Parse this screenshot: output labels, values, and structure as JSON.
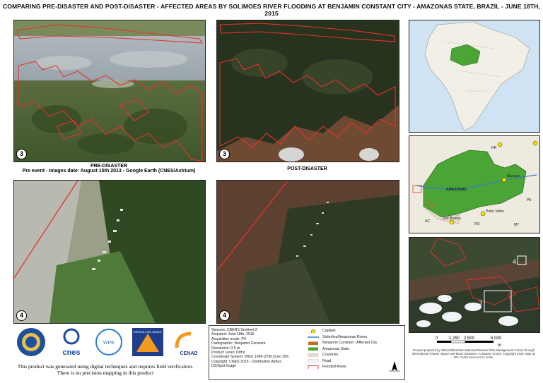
{
  "title": "COMPARING PRE-DISASTER AND POST-DISASTER -  AFFECTED AREAS BY SOLIMOES RIVER FLOODING AT BENJAMIN CONSTANT CITY - AMAZONAS STATE, BRAZIL - JUNE 18TH, 2015",
  "panels": {
    "pre_top_number": "3",
    "post_top_number": "3",
    "pre_bottom_number": "4",
    "post_bottom_number": "4"
  },
  "pre_label": {
    "line1": "PRE-DISASTER",
    "line2": "Pre event - Images date: August 15th 2013 - Google Earth (CNES/Astrium)"
  },
  "post_label": "POST-DISASTER",
  "overview_map": {
    "state_labels": [
      "AMAZONAS",
      "PA",
      "MT",
      "RO",
      "AC",
      "RR"
    ],
    "city_labels": [
      "Manaus",
      "Porto Velho",
      "Rio Branco"
    ],
    "box_labels": [
      "3",
      "4"
    ]
  },
  "legend": {
    "info_lines": [
      "Sensors: CBERS Sentinel-2",
      "Acquired: June 18th, 2015",
      "Acquisition mode: PX",
      "Cartographic: Benjamin Constant",
      "Resolution: 0.5 m",
      "Product Level: Ortho",
      "Coordinate System: WGS 1984 UTM Zone 19S",
      "Copyright: CNES 2015 - Distribution Airbus",
      "DS/Spot Image"
    ],
    "items": [
      {
        "label": "Capitals",
        "symbol": "capital"
      },
      {
        "label": "Solimões/Amazonas Rivers",
        "symbol": "river"
      },
      {
        "label": "Benjamin Constant - Affected City",
        "symbol": "city"
      },
      {
        "label": "Amazonas State",
        "symbol": "state"
      },
      {
        "label": "Countries",
        "symbol": "countries"
      },
      {
        "label": "Road",
        "symbol": "road"
      },
      {
        "label": "Flooded Areas",
        "symbol": "flood"
      }
    ]
  },
  "logos": [
    "ISDR",
    "cnes",
    "WPE",
    "DEFESA CIVIL BRASIL",
    "CENAD"
  ],
  "disclaimer": {
    "line1": "This product was generated using digital techniques and requires field verification.",
    "line2": "There is no precision mapping in this product"
  },
  "scale_bar": {
    "ticks": [
      "0",
      "1.250",
      "2.500",
      "5.000"
    ],
    "unit": "m"
  },
  "credits": "Product prepared by CENAD/Brazilian National Disaster Risk Management Center through International Charter Space and Major Disasters. Activation ID 523. Copyright 2015. Map Id. 001. North arrow not to scale.",
  "colors": {
    "flood_outline": "#e8322b",
    "amazonas_state": "#4aa536",
    "river": "#3a78c8",
    "water_bg": "#6e4a33",
    "ocean": "#cfe3f3"
  }
}
